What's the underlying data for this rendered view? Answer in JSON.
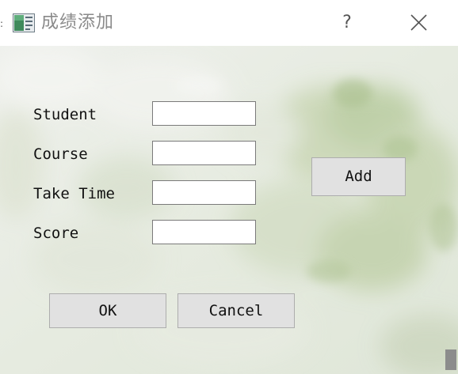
{
  "window": {
    "title": "成绩添加",
    "help_label": "?",
    "close_icon": "close-icon",
    "app_icon": "app-window-icon"
  },
  "form": {
    "fields": [
      {
        "label": "Student",
        "value": ""
      },
      {
        "label": "Course",
        "value": ""
      },
      {
        "label": "Take Time",
        "value": ""
      },
      {
        "label": "Score",
        "value": ""
      }
    ]
  },
  "buttons": {
    "add": "Add",
    "ok": "OK",
    "cancel": "Cancel"
  },
  "colors": {
    "title_text": "#8a8a8a",
    "button_face": "#e1e1e1",
    "button_border": "#adadad",
    "background_tint": "#e9ece4"
  }
}
